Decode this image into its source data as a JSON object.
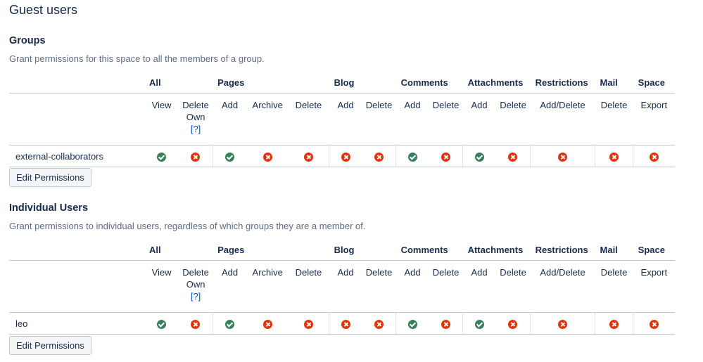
{
  "page_title": "Guest users",
  "header_labels": [
    "All",
    "Pages",
    "Blog",
    "Comments",
    "Attachments",
    "Restrictions",
    "Mail",
    "Space"
  ],
  "sub_labels": [
    "View",
    "Delete Own",
    "Add",
    "Archive",
    "Delete",
    "Add",
    "Delete",
    "Add",
    "Delete",
    "Add",
    "Delete",
    "Add/Delete",
    "Delete",
    "Export"
  ],
  "help_link": "[?]",
  "groups": {
    "title": "Groups",
    "description": "Grant permissions for this space to all the members of a group.",
    "rows": [
      {
        "name": "external-collaborators",
        "perms": [
          true,
          false,
          true,
          false,
          false,
          false,
          false,
          true,
          false,
          true,
          false,
          false,
          false,
          false
        ]
      }
    ],
    "edit_label": "Edit Permissions"
  },
  "individual": {
    "title": "Individual Users",
    "description": "Grant permissions to individual users, regardless of which groups they are a member of.",
    "rows": [
      {
        "name": "leo",
        "perms": [
          true,
          false,
          true,
          false,
          false,
          false,
          false,
          true,
          false,
          true,
          false,
          false,
          false,
          false
        ]
      }
    ],
    "edit_label": "Edit Permissions"
  },
  "colors": {
    "granted": "#36805c",
    "denied": "#de350b",
    "heading": "#172b4d",
    "muted": "#5e6c84",
    "link": "#0052cc"
  },
  "icons": {
    "granted": "check-circle-icon",
    "denied": "cross-circle-icon"
  }
}
